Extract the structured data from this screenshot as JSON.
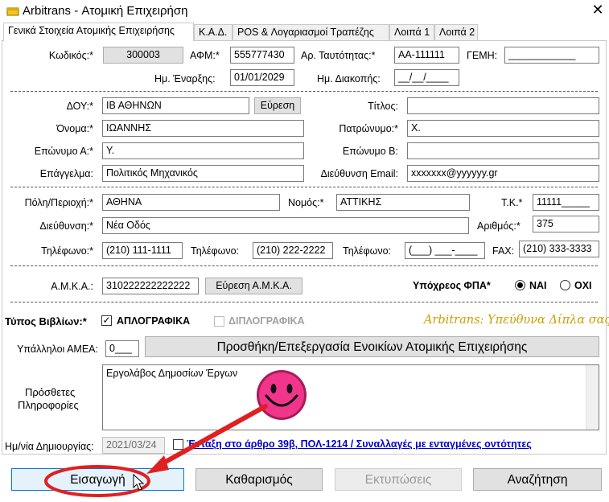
{
  "window": {
    "title": "Arbitrans - Ατομική Επιχειρήση"
  },
  "tabs": [
    {
      "label": "Γενικά Στοιχεία Ατομικής Επιχειρήσης"
    },
    {
      "label": "Κ.Α.Δ."
    },
    {
      "label": "POS & Λογαριασμοί Τραπέζης"
    },
    {
      "label": "Λοιπά 1"
    },
    {
      "label": "Λοιπά 2"
    }
  ],
  "general": {
    "code_label": "Κωδικός:*",
    "code_value": "300003",
    "afm_label": "ΑΦΜ:*",
    "afm_value": "555777430",
    "id_label": "Αρ. Ταυτότητας:*",
    "id_value": "ΑΑ-111111",
    "gemi_label": "ΓΕΜΗ:",
    "gemi_value": "____________",
    "start_label": "Ημ. Έναρξης:",
    "start_value": "01/01/2029",
    "stop_label": "Ημ. Διακοπής:",
    "stop_value": "__/__/____"
  },
  "person": {
    "doy_label": "ΔΟΥ:*",
    "doy_value": "ΙΒ ΑΘΗΝΩΝ",
    "doy_search": "Εύρεση",
    "title_label": "Τίτλος:",
    "title_value": "",
    "name_label": "Όνομα:*",
    "name_value": "ΙΩΑΝΝΗΣ",
    "father_label": "Πατρώνυμο:*",
    "father_value": "Χ.",
    "surname_a_label": "Επώνυμο Α:*",
    "surname_a_value": "Υ.",
    "surname_b_label": "Επώνυμο Β:",
    "surname_b_value": "",
    "job_label": "Επάγγελμα:",
    "job_value": "Πολιτικός Μηχανικός",
    "email_label": "Διεύθυνση Email:",
    "email_value": "xxxxxxx@yyyyyy.gr"
  },
  "address": {
    "city_label": "Πόλη/Περιοχή:*",
    "city_value": "ΑΘΗΝΑ",
    "prefecture_label": "Νομός:*",
    "prefecture_value": "ΑΤΤΙΚΗΣ",
    "zip_label": "Τ.Κ.*",
    "zip_value": "11111_____",
    "street_label": "Διεύθυνση:*",
    "street_value": "Νέα Οδός",
    "number_label": "Αριθμός:*",
    "number_value": "375",
    "phone1_label": "Τηλέφωνο:*",
    "phone1_value": "(210) 111-1111",
    "phone2_label": "Τηλέφωνο:",
    "phone2_value": "(210) 222-2222",
    "phone3_label": "Τηλέφωνο:",
    "phone3_value": "(___) ___-____",
    "fax_label": "FAX:",
    "fax_value": "(210) 333-3333"
  },
  "amka": {
    "label": "Α.Μ.Κ.Α.:",
    "value": "310222222222222",
    "search": "Εύρεση Α.Μ.Κ.Α.",
    "vat_label": "Υπόχρεος ΦΠΑ*",
    "vat_yes": "ΝΑΙ",
    "vat_no": "ΟΧΙ",
    "vat_selected": "ΝΑΙ"
  },
  "books": {
    "label": "Τύπος Βιβλίων:*",
    "simple": "ΑΠΛΟΓΡΑΦΙΚΑ",
    "double": "ΔΙΠΛΟΓΡΑΦΙΚΑ",
    "slogan": "Arbitrans: Υπεύθυνα Δίπλα σας",
    "amea_label": "Υπάλληλοι ΑΜΕΑ:",
    "amea_value": "0___",
    "rent_button": "Προσθήκη/Επεξεργασία Ενοικίων Ατομικής Επιχειρήσης"
  },
  "notes": {
    "label_line1": "Πρόσθετες",
    "label_line2": "Πληροφορίες",
    "value": "Εργολάβος Δημοσίων Έργων"
  },
  "footer": {
    "created_label": "Ημ/νία Δημιουργίας:",
    "created_value": "2021/03/24",
    "article_link": "Ένταξη στο άρθρο 39β, ΠΟΛ-1214 / Συναλλαγές με ενταγμένες οντότητες"
  },
  "actions": {
    "insert": "Εισαγωγή",
    "clear": "Καθαρισμός",
    "print": "Εκτυπώσεις",
    "search": "Αναζήτηση"
  },
  "colors": {
    "slogan": "#c8a000",
    "highlight": "#e02020",
    "link": "#0000cc",
    "smiley": "#f0358a"
  }
}
